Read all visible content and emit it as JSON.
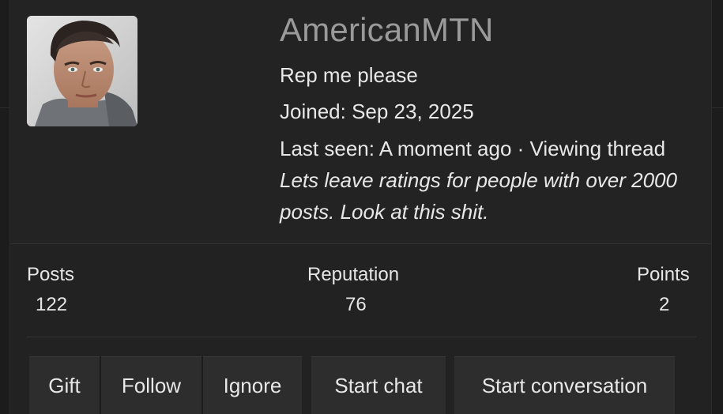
{
  "profile": {
    "username": "AmericanMTN",
    "custom_title": "Rep me please",
    "joined": "Joined: Sep 23, 2025",
    "last_seen_prefix": "Last seen: A moment ago · Viewing thread ",
    "last_seen_thread": "Lets leave ratings for people with over 2000 posts. Look at this shit."
  },
  "stats": {
    "posts_label": "Posts",
    "posts_value": "122",
    "reputation_label": "Reputation",
    "reputation_value": "76",
    "points_label": "Points",
    "points_value": "2"
  },
  "actions": {
    "gift": "Gift",
    "follow": "Follow",
    "ignore": "Ignore",
    "start_chat": "Start chat",
    "start_conversation": "Start conversation"
  },
  "colors": {
    "background": "#171717",
    "card": "#222222",
    "button": "#2d2d2d",
    "username": "#9a9a9a",
    "text": "#e8e8e8"
  }
}
